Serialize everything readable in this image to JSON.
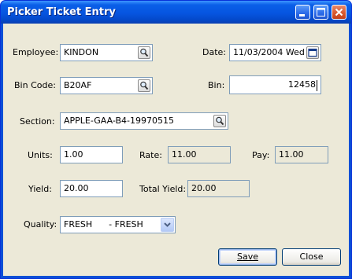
{
  "window": {
    "title": "Picker Ticket Entry"
  },
  "form": {
    "employee": {
      "label": "Employee:",
      "value": "KINDON"
    },
    "date": {
      "label": "Date:",
      "value": "11/03/2004 Wed"
    },
    "bin_code": {
      "label": "Bin Code:",
      "value": "B20AF"
    },
    "bin": {
      "label": "Bin:",
      "value": "12458"
    },
    "section": {
      "label": "Section:",
      "value": "APPLE-GAA-B4-19970515"
    },
    "units": {
      "label": "Units:",
      "value": "1.00"
    },
    "rate": {
      "label": "Rate:",
      "value": "11.00"
    },
    "pay": {
      "label": "Pay:",
      "value": "11.00"
    },
    "yield": {
      "label": "Yield:",
      "value": "20.00"
    },
    "total_yield": {
      "label": "Total Yield:",
      "value": "20.00"
    },
    "quality": {
      "label": "Quality:",
      "value": "FRESH      - FRESH"
    }
  },
  "buttons": {
    "save": "Save",
    "close": "Close"
  },
  "icons": {
    "lookup": "magnifier-icon",
    "calendar": "calendar-icon",
    "dropdown": "chevron-down-icon",
    "minimize": "minimize-icon",
    "maximize": "maximize-icon",
    "close": "close-icon"
  }
}
